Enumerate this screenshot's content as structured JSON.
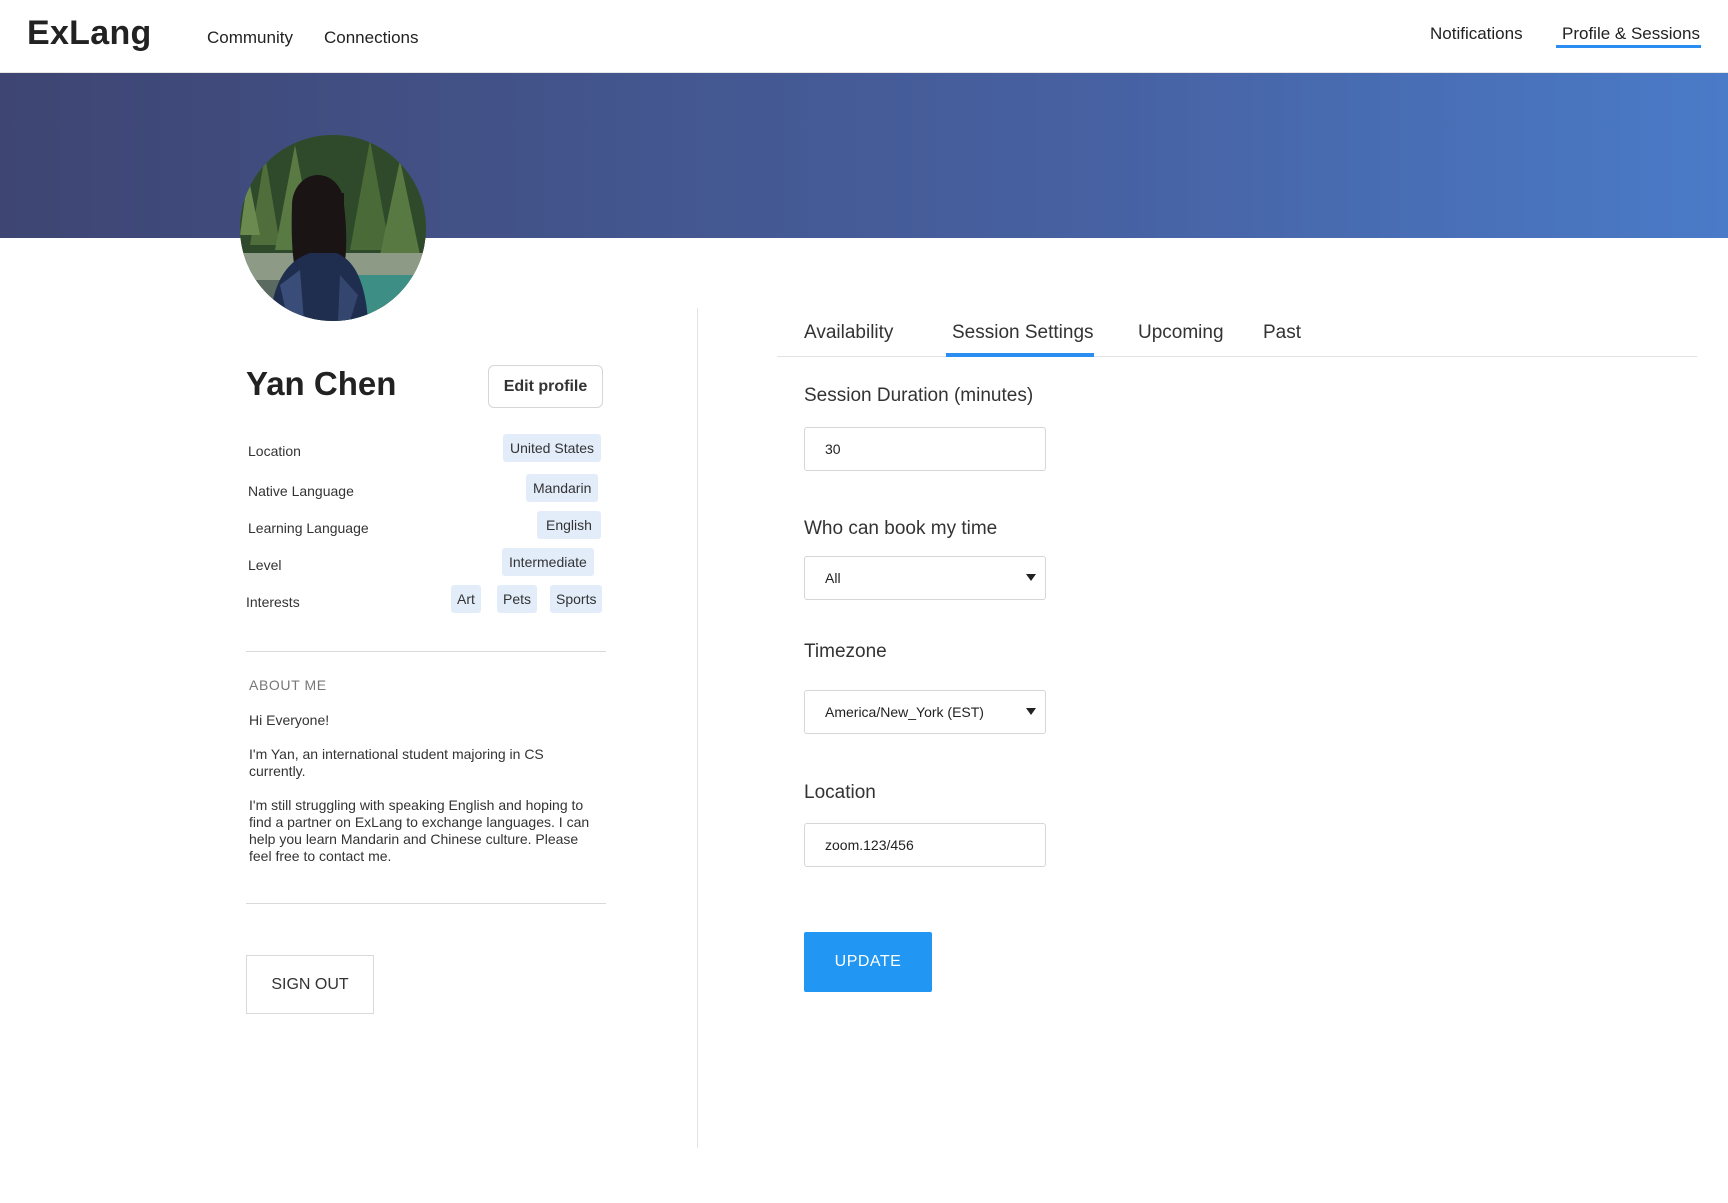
{
  "nav": {
    "logo": "ExLang",
    "community": "Community",
    "connections": "Connections",
    "notifications": "Notifications",
    "profile_sessions": "Profile & Sessions"
  },
  "profile": {
    "name": "Yan Chen",
    "edit_label": "Edit  profile",
    "location_label": "Location",
    "location_value": "United States",
    "native_label": "Native Language",
    "native_value": "Mandarin",
    "learning_label": "Learning Language",
    "learning_value": "English",
    "level_label": "Level",
    "level_value": "Intermediate",
    "interests_label": "Interests",
    "interests": [
      "Art",
      "Pets",
      "Sports"
    ],
    "about_heading": "ABOUT  ME",
    "about": [
      "Hi Everyone!",
      "I'm Yan, an international student majoring in CS currently.",
      "I'm still struggling with speaking English and hoping to find a partner on ExLang to exchange languages. I can help you learn Mandarin and Chinese culture. Please feel free to contact me."
    ],
    "signout_label": "SIGN OUT"
  },
  "tabs": {
    "availability": "Availability",
    "session_settings": "Session Settings",
    "upcoming": "Upcoming",
    "past": "Past",
    "active": "session_settings"
  },
  "settings": {
    "duration_label": "Session Duration (minutes)",
    "duration_value": "30",
    "who_label": "Who can book my time",
    "who_value": "All",
    "timezone_label": "Timezone",
    "timezone_value": "America/New_York (EST)",
    "location_label": "Location",
    "location_value": "zoom.123/456",
    "update_label": "UPDATE"
  },
  "colors": {
    "accent": "#2196f3",
    "chip_bg": "#e3edfa",
    "banner_start": "#3e4572",
    "banner_end": "#4a7bc8"
  }
}
